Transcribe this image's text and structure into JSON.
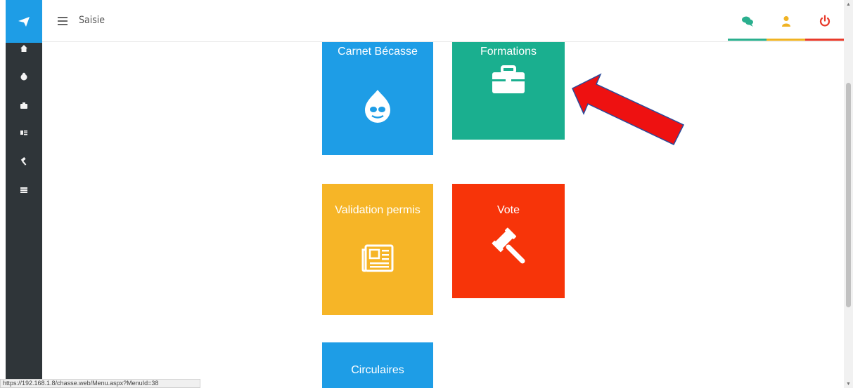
{
  "header": {
    "title": "Saisie",
    "menu_icon": "hamburger-menu-icon",
    "actions": [
      {
        "icon": "chat-icon",
        "color": "#2aaf8e"
      },
      {
        "icon": "user-icon",
        "color": "#f0b323"
      },
      {
        "icon": "power-icon",
        "color": "#e83a2b"
      }
    ]
  },
  "sidebar": {
    "brand_icon": "paper-plane-icon",
    "brand_color": "#1e9de6",
    "items": [
      {
        "icon": "home-icon"
      },
      {
        "icon": "bird-icon"
      },
      {
        "icon": "briefcase-icon"
      },
      {
        "icon": "newspaper-icon"
      },
      {
        "icon": "gavel-icon"
      },
      {
        "icon": "list-icon"
      }
    ]
  },
  "tiles": [
    {
      "label": "Carnet Bécasse",
      "icon": "drupal-icon",
      "color": "#1e9de6"
    },
    {
      "label": "Formations",
      "icon": "briefcase-icon",
      "color": "#1aaf8f"
    },
    {
      "label": "Validation permis",
      "icon": "newspaper-icon",
      "color": "#f6b527"
    },
    {
      "label": "Vote",
      "icon": "gavel-icon",
      "color": "#f73409"
    },
    {
      "label": "Circulaires",
      "icon": "",
      "color": "#1e9de6"
    }
  ],
  "status_bar": {
    "url": "https://192.168.1.8/chasse.web/Menu.aspx?MenuId=38"
  },
  "annotation": {
    "type": "red-arrow",
    "points_to": "Formations",
    "color": "#ee1111"
  }
}
